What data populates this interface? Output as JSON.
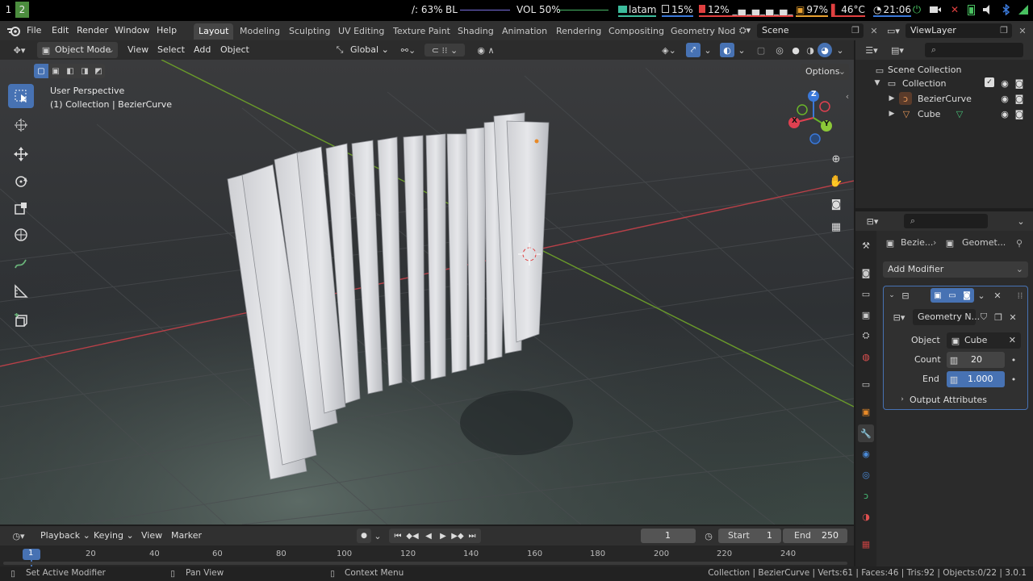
{
  "sysbar": {
    "workspace1": "1",
    "workspace2": "2",
    "cpu": "/: 63%",
    "bl": "BL",
    "vol": "VOL 50%",
    "net": "latam",
    "disk": "15%",
    "mem": "12%",
    "battery": "97%",
    "temp": "46°C",
    "clock": "21:06"
  },
  "menu": {
    "file": "File",
    "edit": "Edit",
    "render": "Render",
    "window": "Window",
    "help": "Help",
    "tabs": [
      "Layout",
      "Modeling",
      "Sculpting",
      "UV Editing",
      "Texture Paint",
      "Shading",
      "Animation",
      "Rendering",
      "Compositing",
      "Geometry Nod"
    ],
    "scene": "Scene",
    "viewlayer": "ViewLayer"
  },
  "viewport": {
    "mode": "Object Mode",
    "view": "View",
    "select": "Select",
    "add": "Add",
    "object": "Object",
    "orientation": "Global",
    "options": "Options",
    "perspective": "User Perspective",
    "collection_info": "(1) Collection | BezierCurve",
    "axis_x": "X",
    "axis_y": "Y",
    "axis_z": "Z"
  },
  "outliner": {
    "scene_collection": "Scene Collection",
    "collection": "Collection",
    "items": [
      "BezierCurve",
      "Cube"
    ]
  },
  "properties": {
    "breadcrumb_object": "Bezie...",
    "breadcrumb_modifier": "Geomet...",
    "add_modifier": "Add Modifier",
    "nodegroup": "Geometry N...",
    "object_label": "Object",
    "object_value": "Cube",
    "count_label": "Count",
    "count_value": "20",
    "end_label": "End",
    "end_value": "1.000",
    "output_attributes": "Output Attributes"
  },
  "timeline": {
    "playback": "Playback",
    "keying": "Keying",
    "view": "View",
    "marker": "Marker",
    "current_frame": "1",
    "start_label": "Start",
    "start_value": "1",
    "end_label": "End",
    "end_value": "250",
    "ticks": [
      "20",
      "40",
      "60",
      "80",
      "100",
      "120",
      "140",
      "160",
      "180",
      "200",
      "220",
      "240"
    ],
    "playhead": "1"
  },
  "status": {
    "left": "Set Active Modifier",
    "middle": "Pan View",
    "right": "Context Menu",
    "stats": "Collection | BezierCurve | Verts:61 | Faces:46 | Tris:92 | Objects:0/22 | 3.0.1"
  },
  "colors": {
    "accent": "#4772b3",
    "axis_x": "#e04050",
    "axis_y": "#6ab42a",
    "axis_z": "#3a78d8",
    "header": "#303030"
  }
}
